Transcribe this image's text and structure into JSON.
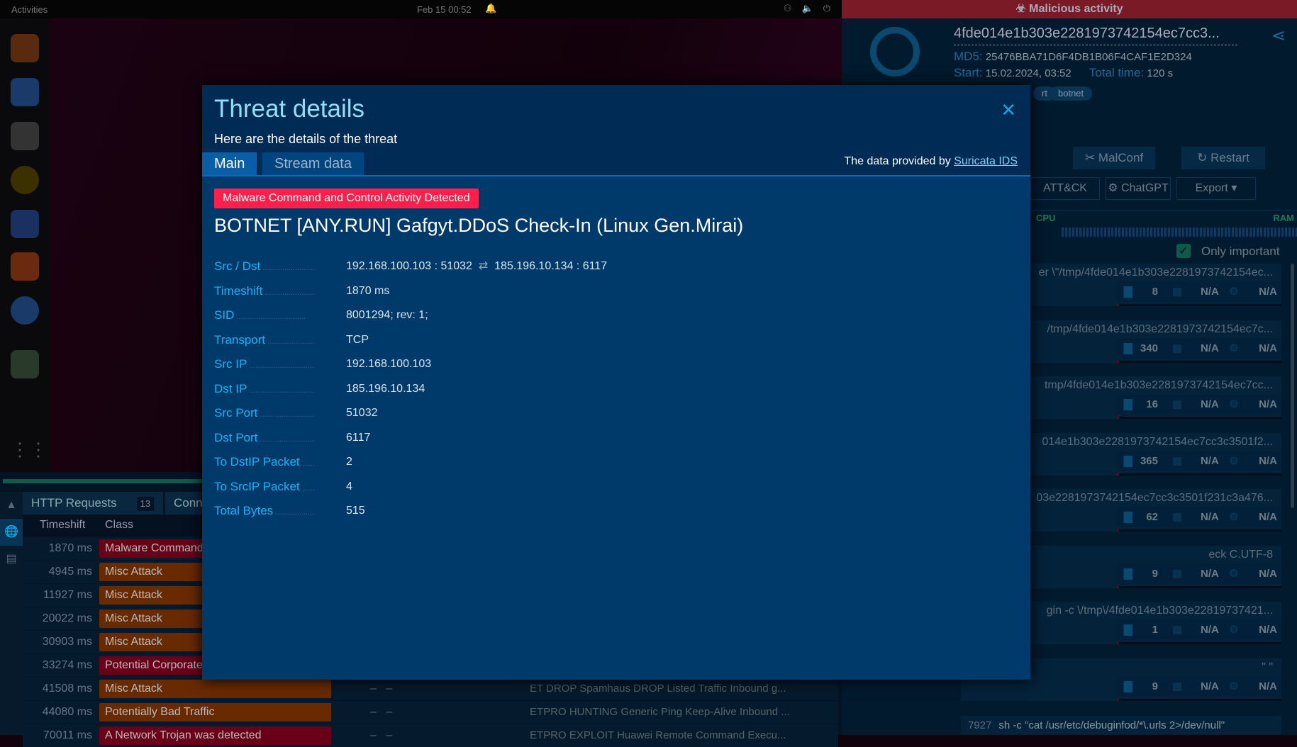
{
  "topbar": {
    "activities": "Activities",
    "clock": "Feb 15  00:52"
  },
  "bottom": {
    "tabs": [
      "HTTP Requests",
      "Conn"
    ],
    "http_count": "13",
    "columns": [
      "Timeshift",
      "Class"
    ],
    "rows": [
      {
        "ts": "1870 ms",
        "cls": "Malware Command",
        "sev": "red",
        "msg": ""
      },
      {
        "ts": "4945 ms",
        "cls": "Misc Attack",
        "sev": "orange",
        "msg": ""
      },
      {
        "ts": "11927 ms",
        "cls": "Misc Attack",
        "sev": "orange",
        "msg": ""
      },
      {
        "ts": "20022 ms",
        "cls": "Misc Attack",
        "sev": "orange",
        "msg": ""
      },
      {
        "ts": "30903 ms",
        "cls": "Misc Attack",
        "sev": "orange",
        "msg": ""
      },
      {
        "ts": "33274 ms",
        "cls": "Potential Corporate",
        "sev": "red",
        "msg": ""
      },
      {
        "ts": "41508 ms",
        "cls": "Misc Attack",
        "sev": "orange",
        "msg": "ET DROP Spamhaus DROP Listed Traffic Inbound g..."
      },
      {
        "ts": "44080 ms",
        "cls": "Potentially Bad Traffic",
        "sev": "orange",
        "msg": "ETPRO HUNTING Generic Ping Keep-Alive Inbound ..."
      },
      {
        "ts": "70011 ms",
        "cls": "A Network Trojan was detected",
        "sev": "red",
        "msg": "ETPRO EXPLOIT Huawei Remote Command Execu..."
      }
    ]
  },
  "report": {
    "banner": "Malicious activity",
    "filename": "4fde014e1b303e2281973742154ec7cc3...",
    "md5_label": "MD5:",
    "md5": "25476BBA71D6F4DB1B06F4CAF1E2D324",
    "start_label": "Start:",
    "start": "15.02.2024, 03:52",
    "total_label": "Total time:",
    "total": "120 s",
    "tags": [
      "rt",
      "botnet"
    ],
    "buttons": {
      "malconf": "MalConf",
      "restart": "Restart",
      "attck": "ATT&CK",
      "chatgpt": "ChatGPT",
      "export": "Export"
    },
    "cpu": "CPU",
    "ram": "RAM",
    "only_important": "Only important",
    "processes": [
      {
        "cmd": "er \\\"/tmp/4fde014e1b303e2281973742154ec...",
        "files": "8",
        "net": "N/A",
        "reg": "N/A"
      },
      {
        "cmd": "/tmp/4fde014e1b303e2281973742154ec7c...",
        "files": "340",
        "net": "N/A",
        "reg": "N/A"
      },
      {
        "cmd": "tmp/4fde014e1b303e2281973742154ec7cc...",
        "files": "16",
        "net": "N/A",
        "reg": "N/A"
      },
      {
        "cmd": "014e1b303e2281973742154ec7cc3c3501f2...",
        "files": "365",
        "net": "N/A",
        "reg": "N/A"
      },
      {
        "cmd": "03e2281973742154ec7cc3c3501f231c3a476...",
        "files": "62",
        "net": "N/A",
        "reg": "N/A"
      },
      {
        "cmd": "eck   C.UTF-8",
        "files": "9",
        "net": "N/A",
        "reg": "N/A"
      },
      {
        "cmd": "gin -c \\/tmp\\/4fde014e1b303e22819737421...",
        "files": "1",
        "net": "N/A",
        "reg": "N/A"
      },
      {
        "cmd": "\" \"",
        "files": "9",
        "net": "N/A",
        "reg": "N/A"
      }
    ],
    "last_pid": "7927",
    "last_cmd": "sh   -c \"cat /usr/etc/debuginfod/*\\.urls 2>/dev/null\""
  },
  "modal": {
    "title": "Threat details",
    "subtitle": "Here are the details of the threat",
    "tabs": {
      "main": "Main",
      "stream": "Stream data"
    },
    "provided_prefix": "The data provided by ",
    "provided_link": "Suricata IDS",
    "badge": "Malware Command and Control Activity Detected",
    "heading": "BOTNET [ANY.RUN] Gafgyt.DDoS Check-In (Linux Gen.Mirai)",
    "src_dst": {
      "label": "Src / Dst",
      "src": "192.168.100.103 : 51032",
      "dst": "185.196.10.134 : 6117"
    },
    "fields": [
      {
        "label": "Timeshift",
        "value": "1870 ms"
      },
      {
        "label": "SID",
        "value": "8001294; rev: 1;"
      },
      {
        "label": "Transport",
        "value": "TCP"
      },
      {
        "label": "Src IP",
        "value": "192.168.100.103"
      },
      {
        "label": "Dst IP",
        "value": "185.196.10.134"
      },
      {
        "label": "Src Port",
        "value": "51032"
      },
      {
        "label": "Dst Port",
        "value": "6117"
      },
      {
        "label": "To DstIP Packet",
        "value": "2"
      },
      {
        "label": "To SrcIP Packet",
        "value": "4"
      },
      {
        "label": "Total Bytes",
        "value": "515"
      }
    ]
  }
}
